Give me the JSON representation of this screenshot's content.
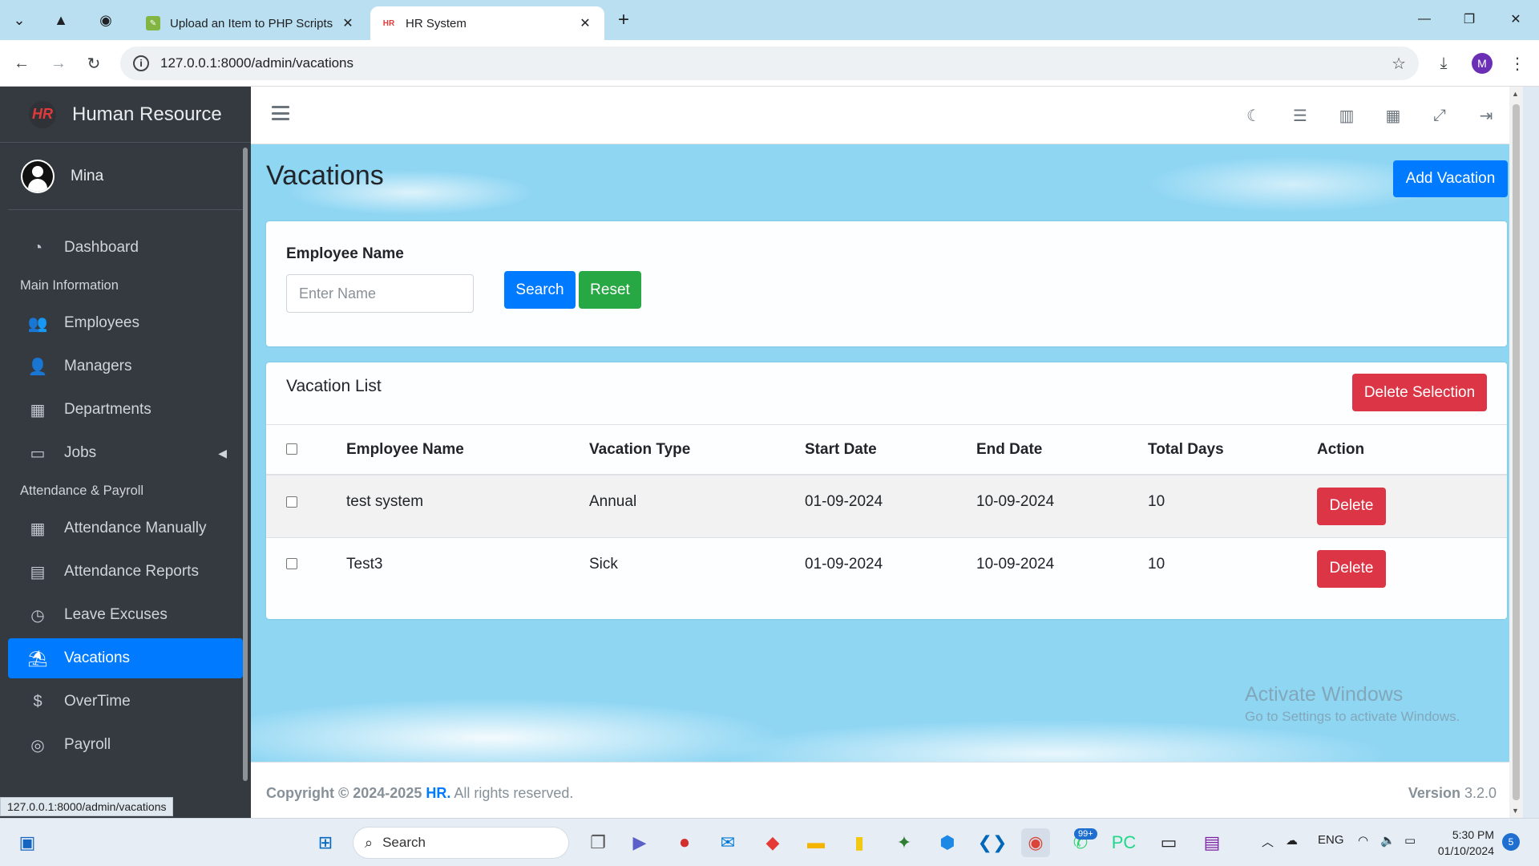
{
  "browser": {
    "tabs": [
      {
        "title": "Upload an Item to PHP Scripts",
        "active": false
      },
      {
        "title": "HR System",
        "active": true
      }
    ],
    "url": "127.0.0.1:8000/admin/vacations",
    "profile_initial": "M",
    "status_url": "127.0.0.1:8000/admin/vacations"
  },
  "sidebar": {
    "brand_logo": "HR",
    "brand": "Human Resource",
    "user": "Mina",
    "items": [
      {
        "label": "Dashboard",
        "icon": "tachometer-icon",
        "glyph": "◔"
      },
      {
        "header": "Main Information"
      },
      {
        "label": "Employees",
        "icon": "users-icon",
        "glyph": "👥"
      },
      {
        "label": "Managers",
        "icon": "user-icon",
        "glyph": "👤"
      },
      {
        "label": "Departments",
        "icon": "building-icon",
        "glyph": "▦"
      },
      {
        "label": "Jobs",
        "icon": "briefcase-icon",
        "glyph": "💼",
        "expandable": true
      },
      {
        "header": "Attendance & Payroll"
      },
      {
        "label": "Attendance Manually",
        "icon": "calendar-icon",
        "glyph": "▦"
      },
      {
        "label": "Attendance Reports",
        "icon": "file-icon",
        "glyph": "🗎"
      },
      {
        "label": "Leave Excuses",
        "icon": "clock-icon",
        "glyph": "◷"
      },
      {
        "label": "Vacations",
        "icon": "umbrella-beach-icon",
        "glyph": "⛱",
        "active": true
      },
      {
        "label": "OverTime",
        "icon": "dollar-icon",
        "glyph": "$"
      },
      {
        "label": "Payroll",
        "icon": "coins-icon",
        "glyph": "◎"
      }
    ]
  },
  "page": {
    "title": "Vacations",
    "add_button": "Add Vacation",
    "filter_label": "Employee Name",
    "filter_placeholder": "Enter Name",
    "search_button": "Search",
    "reset_button": "Reset",
    "list_title": "Vacation List",
    "delete_selection": "Delete Selection",
    "columns": [
      "Employee Name",
      "Vacation Type",
      "Start Date",
      "End Date",
      "Total Days",
      "Action"
    ],
    "rows": [
      {
        "employee": "test system",
        "type": "Annual",
        "start": "01-09-2024",
        "end": "10-09-2024",
        "days": "10",
        "action": "Delete"
      },
      {
        "employee": "Test3",
        "type": "Sick",
        "start": "01-09-2024",
        "end": "10-09-2024",
        "days": "10",
        "action": "Delete"
      }
    ]
  },
  "footer": {
    "copyright_prefix": "Copyright © 2024-2025",
    "brand": "HR.",
    "suffix": "All rights reserved.",
    "version_label": "Version",
    "version": "3.2.0"
  },
  "watermark": {
    "line1": "Activate Windows",
    "line2": "Go to Settings to activate Windows."
  },
  "taskbar": {
    "search": "Search",
    "language": "ENG",
    "time": "5:30 PM",
    "date": "01/10/2024",
    "badge": "99+",
    "notifications": "5"
  },
  "colors": {
    "primary": "#007bff",
    "success": "#28a745",
    "danger": "#dc3545",
    "sidebar": "#343a40"
  }
}
